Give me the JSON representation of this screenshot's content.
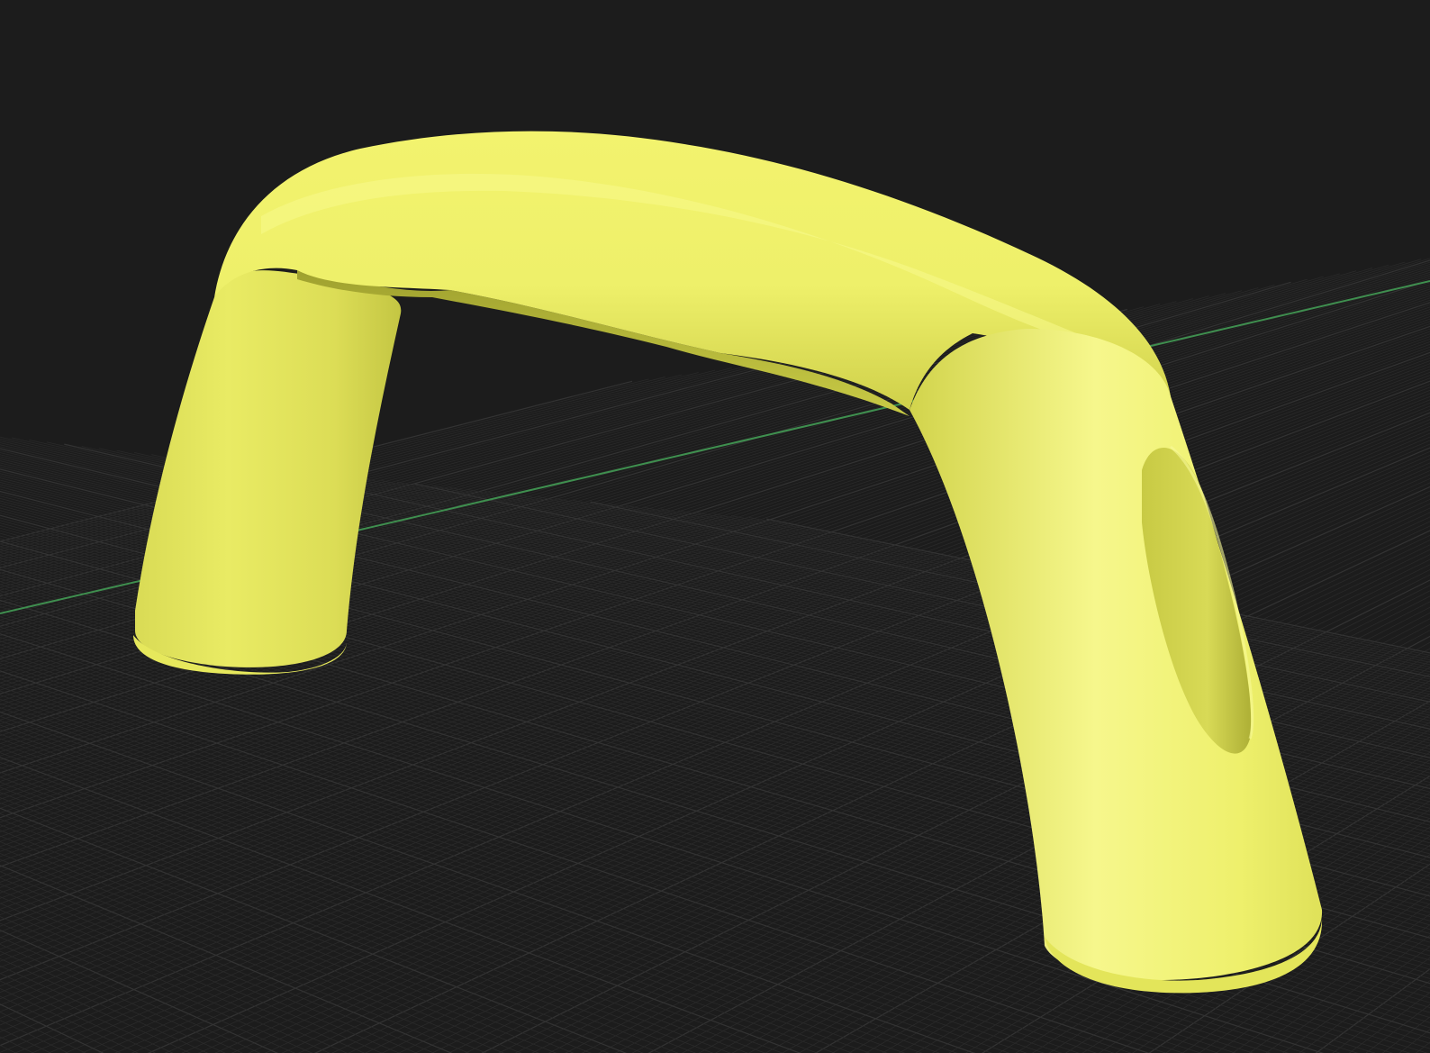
{
  "viewport": {
    "background_color": "#1c1c1c",
    "grid_minor_color": "#2a2a2a",
    "grid_major_color": "#333333",
    "axis_color": "#3f8f4f"
  },
  "model": {
    "type": "arch-handle",
    "color": "#eef06a",
    "shade_color": "#b9bb3e",
    "highlight_color": "#fafc98",
    "features": [
      "curved-bar",
      "two-legs",
      "oval-recess-on-right-leg"
    ]
  }
}
